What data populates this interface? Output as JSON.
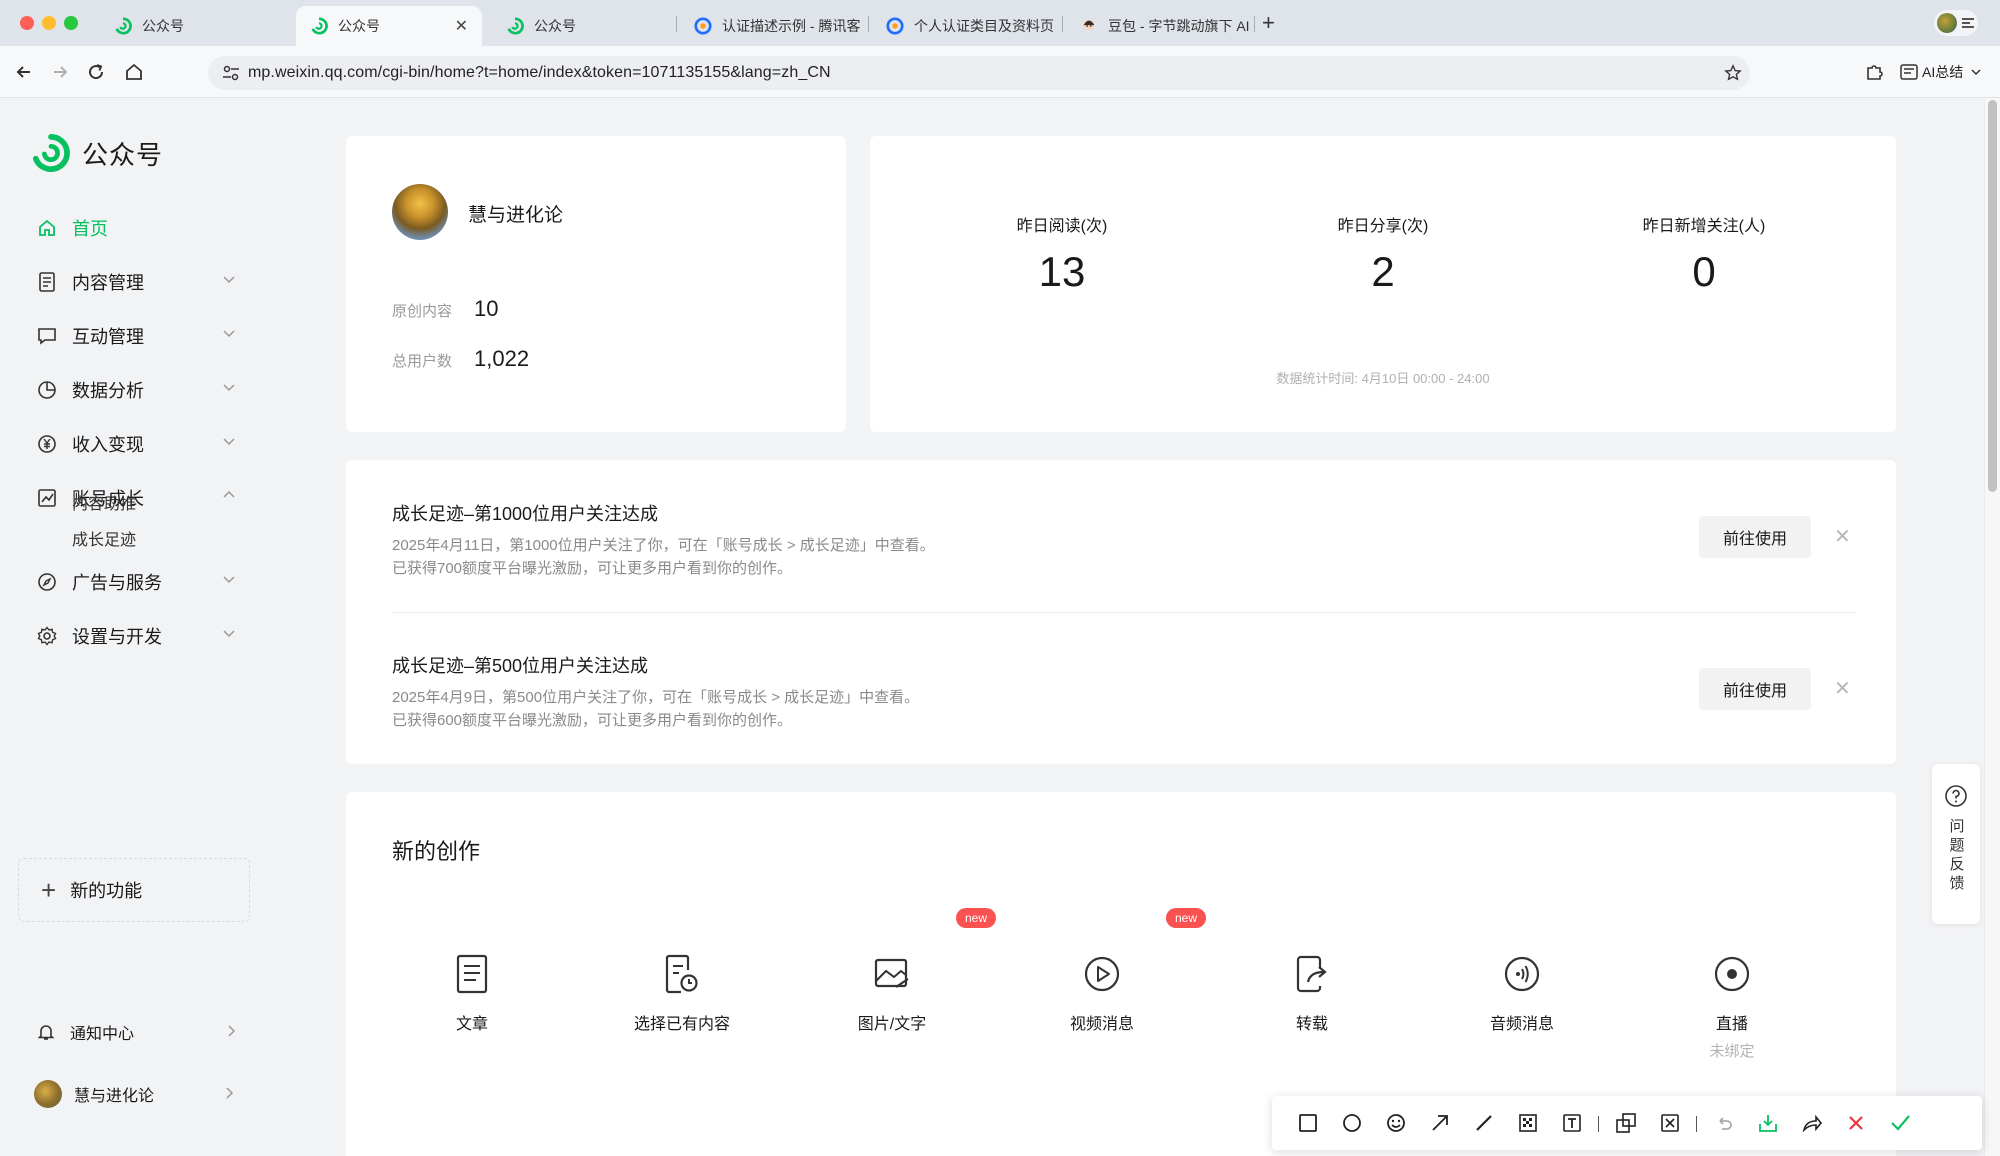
{
  "browser": {
    "tabs": [
      {
        "label": "公众号"
      },
      {
        "label": "公众号"
      },
      {
        "label": "公众号"
      },
      {
        "label": "认证描述示例 - 腾讯客"
      },
      {
        "label": "个人认证类目及资料页"
      },
      {
        "label": "豆包 - 字节跳动旗下 AI"
      }
    ],
    "new_tab": "+",
    "url": "mp.weixin.qq.com/cgi-bin/home?t=home/index&token=1071135155&lang=zh_CN",
    "ai_summary": "AI总结"
  },
  "sidebar": {
    "logo_text": "公众号",
    "items": [
      {
        "label": "首页",
        "icon": "home-icon"
      },
      {
        "label": "内容管理",
        "icon": "document-icon"
      },
      {
        "label": "互动管理",
        "icon": "message-icon"
      },
      {
        "label": "数据分析",
        "icon": "pie-chart-icon"
      },
      {
        "label": "收入变现",
        "icon": "yen-icon"
      },
      {
        "label": "账号成长",
        "icon": "growth-chart-icon"
      }
    ],
    "growth_sub": [
      "内容助推",
      "成长足迹"
    ],
    "items2": [
      {
        "label": "广告与服务",
        "icon": "compass-icon"
      },
      {
        "label": "设置与开发",
        "icon": "gear-icon"
      }
    ],
    "new_features": "新的功能",
    "notification": "通知中心",
    "account": "慧与进化论"
  },
  "profile": {
    "name": "慧与进化论",
    "original_label": "原创内容",
    "original_value": "10",
    "users_label": "总用户数",
    "users_value": "1,022"
  },
  "stats": {
    "items": [
      {
        "label": "昨日阅读(次)",
        "value": "13"
      },
      {
        "label": "昨日分享(次)",
        "value": "2"
      },
      {
        "label": "昨日新增关注(人)",
        "value": "0"
      }
    ],
    "note": "数据统计时间: 4月10日 00:00 - 24:00"
  },
  "notices": [
    {
      "title": "成长足迹–第1000位用户关注达成",
      "line1": "2025年4月11日，第1000位用户关注了你，可在「账号成长 > 成长足迹」中查看。",
      "line2": "已获得700额度平台曝光激励，可让更多用户看到你的创作。",
      "button": "前往使用"
    },
    {
      "title": "成长足迹–第500位用户关注达成",
      "line1": "2025年4月9日，第500位用户关注了你，可在「账号成长 > 成长足迹」中查看。",
      "line2": "已获得600额度平台曝光激励，可让更多用户看到你的创作。",
      "button": "前往使用"
    }
  ],
  "create": {
    "title": "新的创作",
    "badge": "new",
    "tools": [
      {
        "label": "文章",
        "icon": "article-icon"
      },
      {
        "label": "选择已有内容",
        "icon": "existing-content-icon"
      },
      {
        "label": "图片/文字",
        "icon": "image-text-icon",
        "badge": true
      },
      {
        "label": "视频消息",
        "icon": "video-play-icon",
        "badge": true
      },
      {
        "label": "转载",
        "icon": "repost-icon"
      },
      {
        "label": "音频消息",
        "icon": "audio-icon"
      },
      {
        "label": "直播",
        "icon": "live-icon",
        "sub": "未绑定"
      }
    ]
  },
  "feedback": "问题反馈",
  "colors": {
    "brand_green": "#07c160",
    "badge_red": "#fa5151",
    "close_red": "#e8383d",
    "confirm_green": "#07c160"
  }
}
